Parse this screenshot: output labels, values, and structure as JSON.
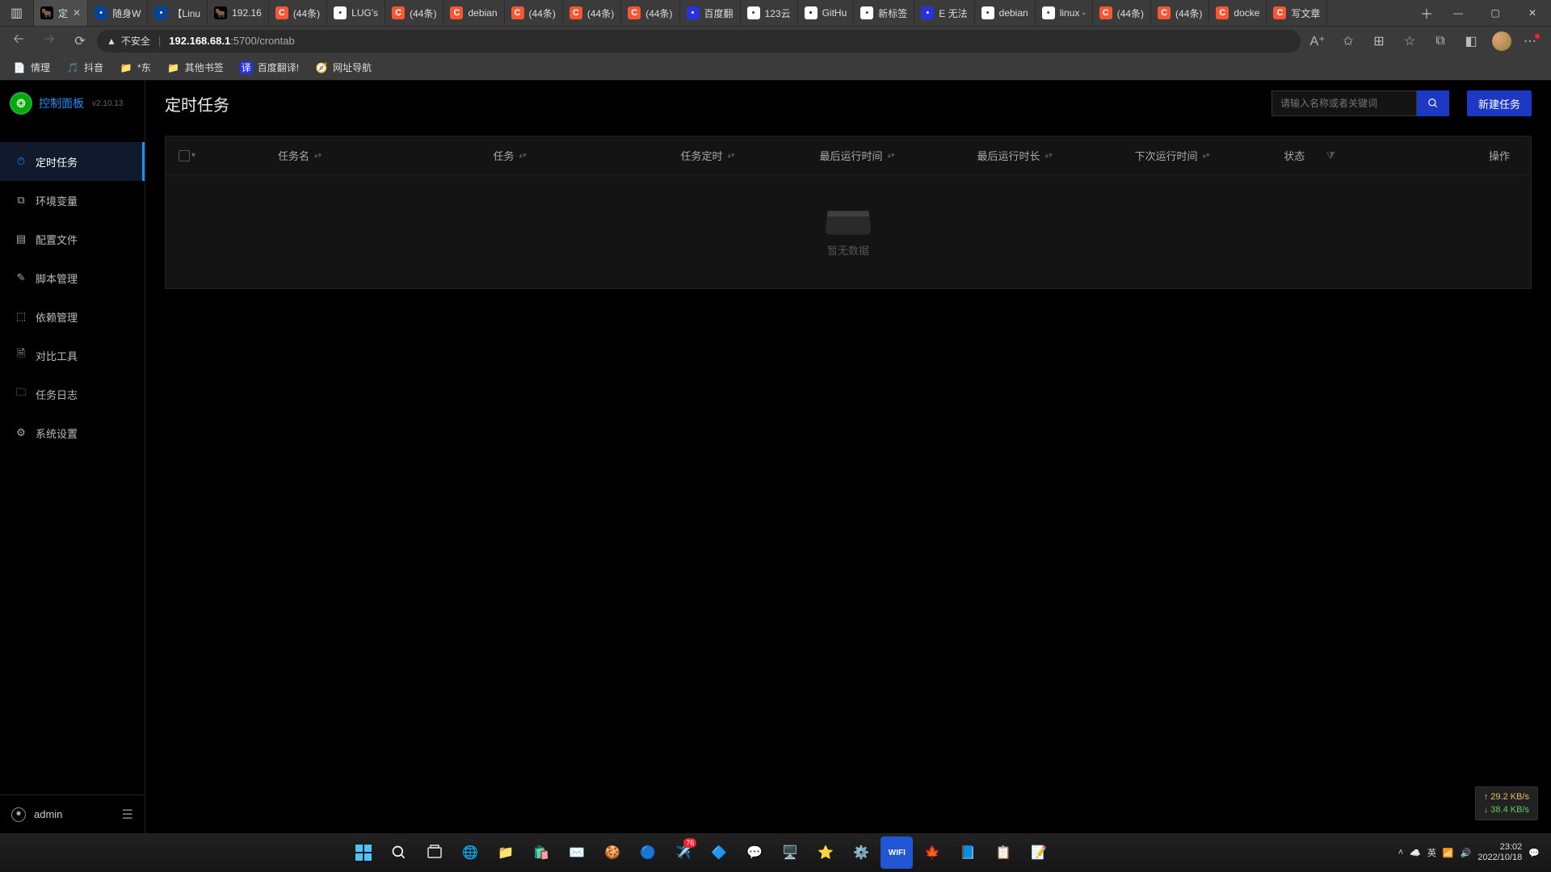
{
  "browser": {
    "tabs": [
      {
        "label": "定",
        "fav": "fav-ql",
        "active": true,
        "close": true
      },
      {
        "label": "随身W",
        "fav": "fav-edge"
      },
      {
        "label": "【Linu",
        "fav": "fav-edge"
      },
      {
        "label": "192.16",
        "fav": "fav-ql"
      },
      {
        "label": "(44条)",
        "fav": "fav-csdn"
      },
      {
        "label": "LUG's",
        "fav": "fav-white"
      },
      {
        "label": "(44条)",
        "fav": "fav-csdn"
      },
      {
        "label": "debian",
        "fav": "fav-csdn"
      },
      {
        "label": "(44条)",
        "fav": "fav-csdn"
      },
      {
        "label": "(44条)",
        "fav": "fav-csdn"
      },
      {
        "label": "(44条)",
        "fav": "fav-csdn"
      },
      {
        "label": "百度翻",
        "fav": "fav-baidu"
      },
      {
        "label": "123云",
        "fav": "fav-white"
      },
      {
        "label": "GitHu",
        "fav": "fav-github"
      },
      {
        "label": "新标签",
        "fav": "fav-white"
      },
      {
        "label": "E 无法",
        "fav": "fav-baidu"
      },
      {
        "label": "debian",
        "fav": "fav-white"
      },
      {
        "label": "linux -",
        "fav": "fav-white"
      },
      {
        "label": "(44条)",
        "fav": "fav-csdn"
      },
      {
        "label": "(44条)",
        "fav": "fav-csdn"
      },
      {
        "label": "docke",
        "fav": "fav-csdn"
      },
      {
        "label": "写文章",
        "fav": "fav-csdn"
      }
    ],
    "security_label": "不安全",
    "url_host": "192.168.68.1",
    "url_path": ":5700/crontab",
    "bookmarks": [
      {
        "icon": "📄",
        "label": "情理"
      },
      {
        "icon": "🎵",
        "label": "抖音"
      },
      {
        "icon": "📁",
        "label": "*东"
      },
      {
        "icon": "📁",
        "label": "其他书签"
      },
      {
        "icon": "译",
        "label": "百度翻译!",
        "cls": "fav-baidu"
      },
      {
        "icon": "🧭",
        "label": "网址导航"
      }
    ]
  },
  "sidebar": {
    "brand": "控制面板",
    "version": "v2.10.13",
    "items": [
      {
        "icon": "⏱",
        "label": "定时任务",
        "active": true
      },
      {
        "icon": "⧉",
        "label": "环境变量"
      },
      {
        "icon": "▤",
        "label": "配置文件"
      },
      {
        "icon": "✎",
        "label": "脚本管理"
      },
      {
        "icon": "⬚",
        "label": "依赖管理"
      },
      {
        "icon": "🗎",
        "label": "对比工具"
      },
      {
        "icon": "🗀",
        "label": "任务日志"
      },
      {
        "icon": "⚙",
        "label": "系统设置"
      }
    ],
    "user": "admin"
  },
  "page": {
    "title": "定时任务",
    "search_placeholder": "请输入名称或者关键词",
    "new_button": "新建任务",
    "columns": {
      "name": "任务名",
      "command": "任务",
      "schedule": "任务定时",
      "last_run": "最后运行时间",
      "duration": "最后运行时长",
      "next_run": "下次运行时间",
      "status": "状态",
      "action": "操作"
    },
    "empty": "暂无数据"
  },
  "netspeed": {
    "up": "29.2 KB/s",
    "down": "38.4 KB/s"
  },
  "system": {
    "ime": "英",
    "time": "23:02",
    "date": "2022/10/18"
  }
}
